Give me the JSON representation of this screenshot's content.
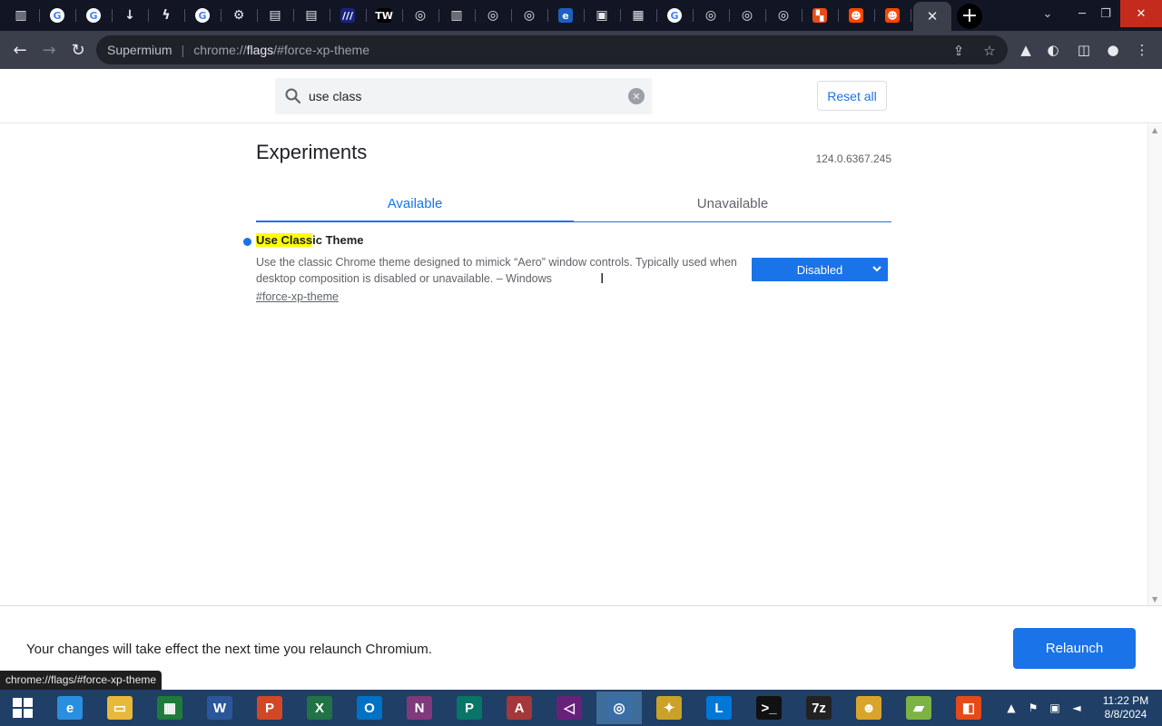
{
  "browser": {
    "tabs": [
      {
        "icon": "library-icon",
        "glyph": "▥",
        "color": "#3b3f4b"
      },
      {
        "icon": "google-icon",
        "glyph": "G",
        "color": "#ffffff"
      },
      {
        "icon": "google-icon",
        "glyph": "G",
        "color": "#ffffff"
      },
      {
        "icon": "download-icon",
        "glyph": "↓",
        "color": "#3b3f4b"
      },
      {
        "icon": "bolt-icon",
        "glyph": "ϟ",
        "color": "#3b3f4b"
      },
      {
        "icon": "google-icon",
        "glyph": "G",
        "color": "#ffffff"
      },
      {
        "icon": "settings-icon",
        "glyph": "⚙",
        "color": "#3b3f4b"
      },
      {
        "icon": "document-icon",
        "glyph": "▤",
        "color": "#3b3f4b"
      },
      {
        "icon": "document-icon",
        "glyph": "▤",
        "color": "#3b3f4b"
      },
      {
        "icon": "italic-icon",
        "glyph": "///",
        "color": "#1a237e"
      },
      {
        "icon": "tw-icon",
        "glyph": "TW",
        "color": "#000000"
      },
      {
        "icon": "chromium-icon",
        "glyph": "◎",
        "color": "#3b3f4b"
      },
      {
        "icon": "library-icon",
        "glyph": "▥",
        "color": "#3b3f4b"
      },
      {
        "icon": "chromium-icon",
        "glyph": "◎",
        "color": "#3b3f4b"
      },
      {
        "icon": "chromium-icon",
        "glyph": "◎",
        "color": "#3b3f4b"
      },
      {
        "icon": "ie-icon",
        "glyph": "e",
        "color": "#1e5fbf"
      },
      {
        "icon": "image-icon",
        "glyph": "▣",
        "color": "#3b3f4b"
      },
      {
        "icon": "book-icon",
        "glyph": "▦",
        "color": "#3b3f4b"
      },
      {
        "icon": "google-icon",
        "glyph": "G",
        "color": "#ffffff"
      },
      {
        "icon": "chromium-icon",
        "glyph": "◎",
        "color": "#3b3f4b"
      },
      {
        "icon": "chromium-icon",
        "glyph": "◎",
        "color": "#3b3f4b"
      },
      {
        "icon": "chromium-icon",
        "glyph": "◎",
        "color": "#3b3f4b"
      },
      {
        "icon": "microsoft-icon",
        "glyph": "▚",
        "color": "#e74c1c"
      },
      {
        "icon": "reddit-icon",
        "glyph": "☻",
        "color": "#ff4500"
      },
      {
        "icon": "reddit-icon",
        "glyph": "☻",
        "color": "#ff4500"
      }
    ],
    "active_tab_close": "✕",
    "new_tab": "+",
    "omnibox": {
      "app": "Supermium",
      "divider": "|",
      "scheme": "chrome://",
      "host": "flags",
      "path": "/#force-xp-theme"
    }
  },
  "header": {
    "search_value": "use class",
    "reset_all": "Reset all"
  },
  "main": {
    "title": "Experiments",
    "version": "124.0.6367.245",
    "tabs": [
      {
        "label": "Available"
      },
      {
        "label": "Unavailable"
      }
    ],
    "flag": {
      "title_highlight": "Use Class",
      "title_rest": "ic Theme",
      "description": "Use the classic Chrome theme designed to mimick “Aero” window controls. Typically used when desktop composition is disabled or unavailable. – Windows",
      "link": "#force-xp-theme",
      "selected_value": "Disabled"
    }
  },
  "relaunch": {
    "message": "Your changes will take effect the next time you relaunch Chromium.",
    "button": "Relaunch"
  },
  "status_url": "chrome://flags/#force-xp-theme",
  "taskbar": {
    "apps": [
      {
        "name": "internet-explorer-icon",
        "glyph": "e",
        "color": "#2b8fe0"
      },
      {
        "name": "file-explorer-icon",
        "glyph": "▭",
        "color": "#e8b839"
      },
      {
        "name": "project-icon",
        "glyph": "▦",
        "color": "#1e7b3a"
      },
      {
        "name": "word-icon",
        "glyph": "W",
        "color": "#2b579a"
      },
      {
        "name": "powerpoint-icon",
        "glyph": "P",
        "color": "#d24726"
      },
      {
        "name": "excel-icon",
        "glyph": "X",
        "color": "#217346"
      },
      {
        "name": "outlook-icon",
        "glyph": "O",
        "color": "#0072c6"
      },
      {
        "name": "onenote-icon",
        "glyph": "N",
        "color": "#80397b"
      },
      {
        "name": "publisher-icon",
        "glyph": "P",
        "color": "#077568"
      },
      {
        "name": "access-icon",
        "glyph": "A",
        "color": "#a4373a"
      },
      {
        "name": "visual-studio-icon",
        "glyph": "◁",
        "color": "#68217a"
      },
      {
        "name": "chromium-icon",
        "glyph": "◎",
        "color": "#3a6ea5"
      },
      {
        "name": "bee-icon",
        "glyph": "✦",
        "color": "#c9a227"
      },
      {
        "name": "lync-icon",
        "glyph": "L",
        "color": "#0078d7"
      },
      {
        "name": "terminal-icon",
        "glyph": ">_",
        "color": "#111111"
      },
      {
        "name": "7zip-icon",
        "glyph": "7z",
        "color": "#222222"
      },
      {
        "name": "monkey-icon",
        "glyph": "☻",
        "color": "#d8a52a"
      },
      {
        "name": "chart-app-icon",
        "glyph": "▰",
        "color": "#7cb342"
      },
      {
        "name": "office-icon",
        "glyph": "◧",
        "color": "#e64a19"
      }
    ],
    "time": "11:22 PM",
    "date": "8/8/2024"
  },
  "colors": {
    "accent": "#1a73e8",
    "highlight": "#ffff00",
    "titlebar": "#121624",
    "toolbar": "#3b3f4b",
    "taskbar": "#1f3f67"
  }
}
